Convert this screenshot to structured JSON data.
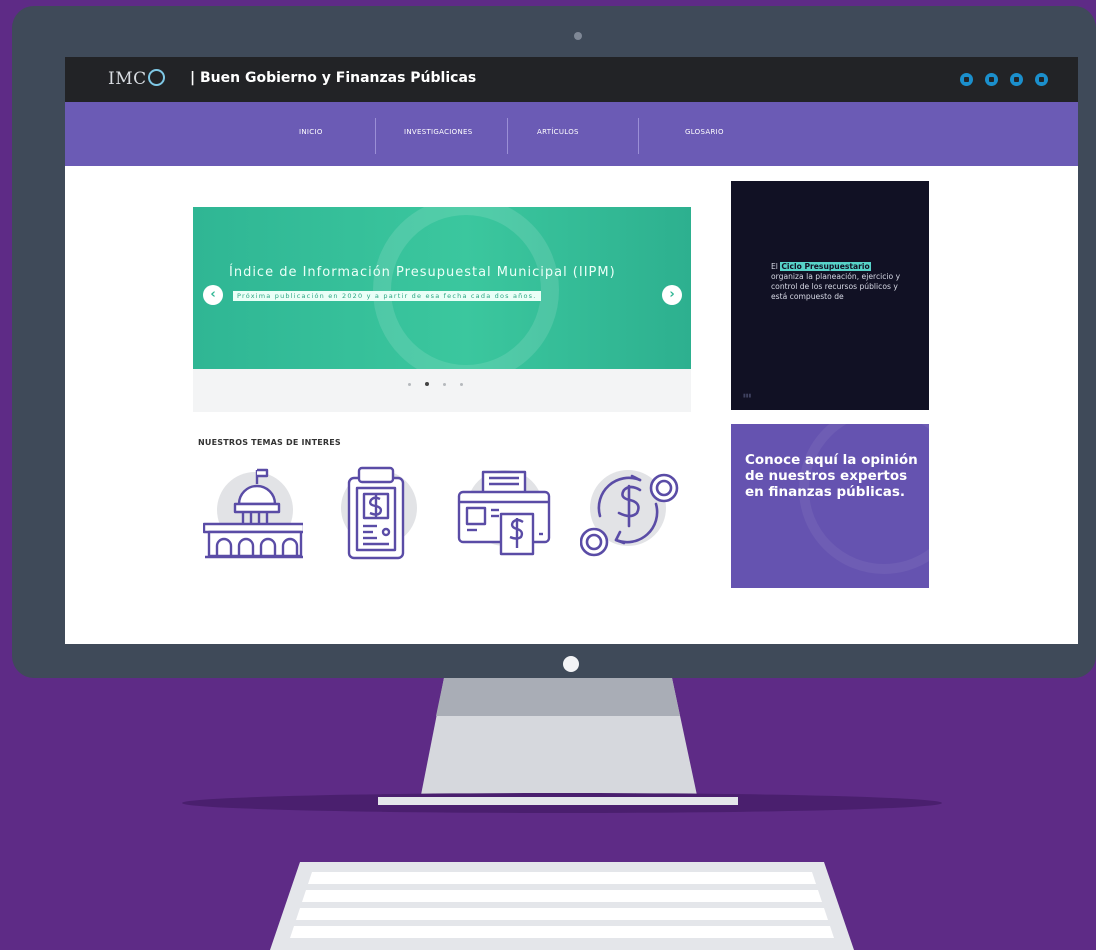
{
  "site": {
    "logo_text": "IMC",
    "title": "| Buen Gobierno y Finanzas Públicas",
    "social_icons": [
      "facebook-icon",
      "twitter-icon",
      "youtube-icon",
      "instagram-icon"
    ]
  },
  "nav": {
    "items": [
      {
        "label": "INICIO"
      },
      {
        "label": "INVESTIGACIONES"
      },
      {
        "label": "ARTÍCULOS"
      },
      {
        "label": "GLOSARIO"
      }
    ]
  },
  "carousel": {
    "title": "Índice de Información Presupuestal Municipal (IIPM)",
    "subtitle": "Próxima publicación en 2020 y a partir de esa fecha cada dos años.",
    "prev_icon": "chevron-left-icon",
    "next_icon": "chevron-right-icon",
    "slide_count": 4,
    "active_slide": 2
  },
  "side_card": {
    "text_prefix": "El ",
    "highlight": "Ciclo Presupuestario",
    "text_rest": " organiza la planeación, ejercicio y control de los recursos públicos y está compuesto de"
  },
  "promo_card": {
    "text": "Conoce aquí la opinión de nuestros expertos en finanzas públicas."
  },
  "topics": {
    "title": "NUESTROS TEMAS DE INTERES",
    "icons": [
      "government-building-icon",
      "budget-clipboard-icon",
      "payment-printer-icon",
      "money-exchange-icon"
    ]
  },
  "colors": {
    "background": "#5e2b86",
    "nav": "#6b5bb5",
    "slide": "#3bc79e",
    "dark_card": "#111124",
    "promo_card": "#6553b0",
    "header": "#222326"
  }
}
